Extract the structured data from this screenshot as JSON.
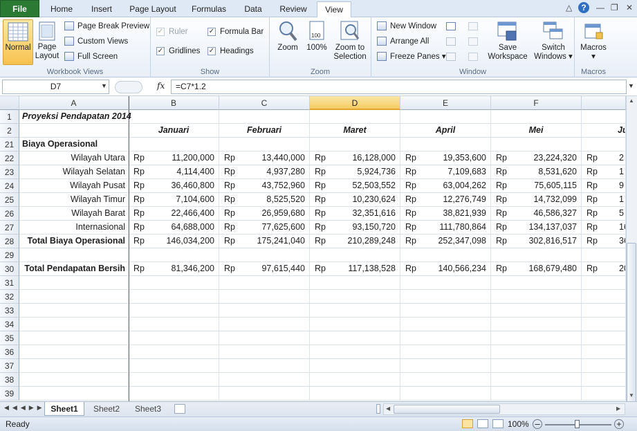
{
  "tabs": [
    "File",
    "Home",
    "Insert",
    "Page Layout",
    "Formulas",
    "Data",
    "Review",
    "View"
  ],
  "active_tab": "View",
  "ribbon": {
    "workbook_views": {
      "label": "Workbook Views",
      "normal": "Normal",
      "page_layout_1": "Page",
      "page_layout_2": "Layout",
      "page_break_preview": "Page Break Preview",
      "custom_views": "Custom Views",
      "full_screen": "Full Screen"
    },
    "show": {
      "label": "Show",
      "ruler": "Ruler",
      "gridlines": "Gridlines",
      "formula_bar": "Formula Bar",
      "headings": "Headings"
    },
    "zoom": {
      "label": "Zoom",
      "zoom": "Zoom",
      "hundred": "100%",
      "zoom_to_1": "Zoom to",
      "zoom_to_2": "Selection"
    },
    "window": {
      "label": "Window",
      "new_window": "New Window",
      "arrange_all": "Arrange All",
      "freeze_panes": "Freeze Panes",
      "save_ws_1": "Save",
      "save_ws_2": "Workspace",
      "switch_1": "Switch",
      "switch_2": "Windows"
    },
    "macros": {
      "label": "Macros",
      "macros": "Macros"
    }
  },
  "formula_bar": {
    "name_box": "D7",
    "fx": "fx",
    "formula": "=C7*1.2"
  },
  "columns": [
    "A",
    "B",
    "C",
    "D",
    "E",
    "F"
  ],
  "rows": [
    {
      "num": "1",
      "a": "Proyeksi Pendapatan 2014",
      "cells": []
    },
    {
      "num": "2",
      "a": "",
      "months": [
        "Januari",
        "Februari",
        "Maret",
        "April",
        "Mei",
        "Ju"
      ]
    },
    {
      "num": "21",
      "a": "Biaya Operasional",
      "cells": []
    },
    {
      "num": "22",
      "a": "Wilayah Utara",
      "cur": "Rp",
      "cells": [
        "11,200,000",
        "13,440,000",
        "16,128,000",
        "19,353,600",
        "23,224,320",
        "2"
      ]
    },
    {
      "num": "23",
      "a": "Wilayah Selatan",
      "cur": "Rp",
      "cells": [
        "4,114,400",
        "4,937,280",
        "5,924,736",
        "7,109,683",
        "8,531,620",
        "1"
      ]
    },
    {
      "num": "24",
      "a": "Wilayah Pusat",
      "cur": "Rp",
      "cells": [
        "36,460,800",
        "43,752,960",
        "52,503,552",
        "63,004,262",
        "75,605,115",
        "9"
      ]
    },
    {
      "num": "25",
      "a": "Wilayah Timur",
      "cur": "Rp",
      "cells": [
        "7,104,600",
        "8,525,520",
        "10,230,624",
        "12,276,749",
        "14,732,099",
        "1"
      ]
    },
    {
      "num": "26",
      "a": "Wilayah Barat",
      "cur": "Rp",
      "cells": [
        "22,466,400",
        "26,959,680",
        "32,351,616",
        "38,821,939",
        "46,586,327",
        "5"
      ]
    },
    {
      "num": "27",
      "a": "Internasional",
      "cur": "Rp",
      "cells": [
        "64,688,000",
        "77,625,600",
        "93,150,720",
        "111,780,864",
        "134,137,037",
        "16"
      ]
    },
    {
      "num": "28",
      "a": "Total Biaya Operasional",
      "cur": "Rp",
      "cells": [
        "146,034,200",
        "175,241,040",
        "210,289,248",
        "252,347,098",
        "302,816,517",
        "36"
      ]
    },
    {
      "num": "29",
      "a": "",
      "cells": []
    },
    {
      "num": "30",
      "a": "Total Pendapatan Bersih",
      "cur": "Rp",
      "cells": [
        "81,346,200",
        "97,615,440",
        "117,138,528",
        "140,566,234",
        "168,679,480",
        "20"
      ]
    },
    {
      "num": "31"
    },
    {
      "num": "32"
    },
    {
      "num": "33"
    },
    {
      "num": "34"
    },
    {
      "num": "35"
    },
    {
      "num": "36"
    },
    {
      "num": "37"
    },
    {
      "num": "38"
    },
    {
      "num": "39"
    }
  ],
  "sheets": [
    "Sheet1",
    "Sheet2",
    "Sheet3"
  ],
  "active_sheet": "Sheet1",
  "status": {
    "ready": "Ready",
    "zoom": "100%"
  }
}
